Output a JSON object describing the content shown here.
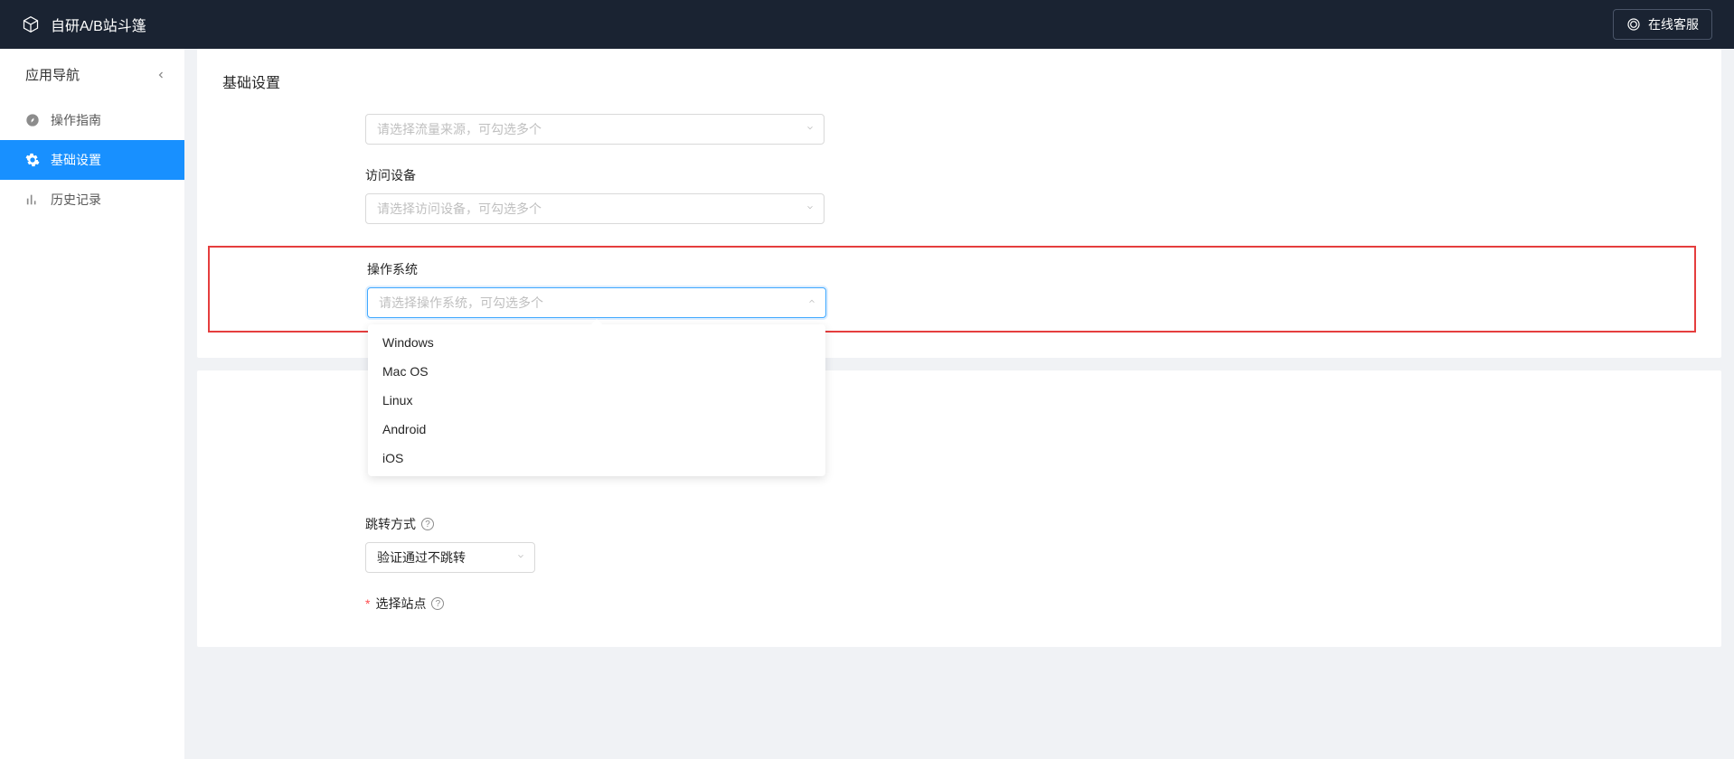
{
  "header": {
    "title": "自研A/B站斗篷",
    "support_label": "在线客服"
  },
  "sidebar": {
    "title": "应用导航",
    "items": [
      {
        "label": "操作指南",
        "icon": "compass"
      },
      {
        "label": "基础设置",
        "icon": "gear"
      },
      {
        "label": "历史记录",
        "icon": "chart"
      }
    ]
  },
  "form": {
    "section_title": "基础设置",
    "traffic_source": {
      "placeholder": "请选择流量来源，可勾选多个"
    },
    "device": {
      "label": "访问设备",
      "placeholder": "请选择访问设备，可勾选多个"
    },
    "os": {
      "label": "操作系统",
      "placeholder": "请选择操作系统，可勾选多个",
      "options": [
        "Windows",
        "Mac OS",
        "Linux",
        "Android",
        "iOS"
      ]
    },
    "redirect": {
      "label": "跳转方式",
      "value": "验证通过不跳转"
    },
    "site": {
      "label": "选择站点"
    }
  }
}
